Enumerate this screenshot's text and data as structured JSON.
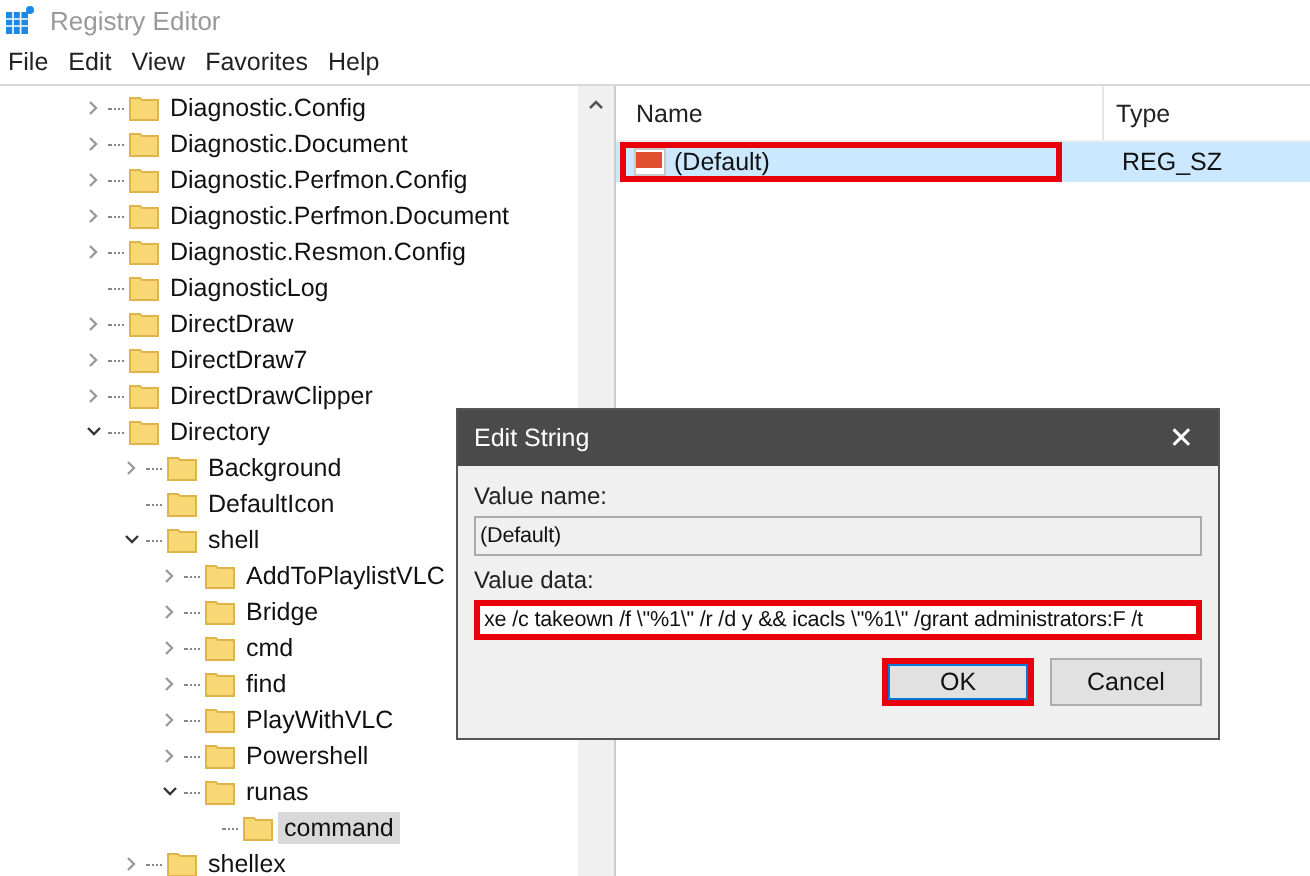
{
  "window": {
    "title": "Registry Editor"
  },
  "menu": [
    "File",
    "Edit",
    "View",
    "Favorites",
    "Help"
  ],
  "tree": [
    {
      "label": "Diagnostic.Config",
      "expandable": true,
      "expanded": false,
      "selected": false
    },
    {
      "label": "Diagnostic.Document",
      "expandable": true,
      "expanded": false,
      "selected": false
    },
    {
      "label": "Diagnostic.Perfmon.Config",
      "expandable": true,
      "expanded": false,
      "selected": false
    },
    {
      "label": "Diagnostic.Perfmon.Document",
      "expandable": true,
      "expanded": false,
      "selected": false
    },
    {
      "label": "Diagnostic.Resmon.Config",
      "expandable": true,
      "expanded": false,
      "selected": false
    },
    {
      "label": "DiagnosticLog",
      "expandable": false,
      "selected": false
    },
    {
      "label": "DirectDraw",
      "expandable": true,
      "expanded": false,
      "selected": false
    },
    {
      "label": "DirectDraw7",
      "expandable": true,
      "expanded": false,
      "selected": false
    },
    {
      "label": "DirectDrawClipper",
      "expandable": true,
      "expanded": false,
      "selected": false
    },
    {
      "label": "Directory",
      "expandable": true,
      "expanded": true,
      "selected": false,
      "children": [
        {
          "label": "Background",
          "expandable": true,
          "expanded": false,
          "selected": false
        },
        {
          "label": "DefaultIcon",
          "expandable": false,
          "selected": false
        },
        {
          "label": "shell",
          "expandable": true,
          "expanded": true,
          "selected": false,
          "children": [
            {
              "label": "AddToPlaylistVLC",
              "expandable": true,
              "expanded": false,
              "selected": false
            },
            {
              "label": "Bridge",
              "expandable": true,
              "expanded": false,
              "selected": false
            },
            {
              "label": "cmd",
              "expandable": true,
              "expanded": false,
              "selected": false
            },
            {
              "label": "find",
              "expandable": true,
              "expanded": false,
              "selected": false
            },
            {
              "label": "PlayWithVLC",
              "expandable": true,
              "expanded": false,
              "selected": false
            },
            {
              "label": "Powershell",
              "expandable": true,
              "expanded": false,
              "selected": false
            },
            {
              "label": "runas",
              "expandable": true,
              "expanded": true,
              "selected": false,
              "children": [
                {
                  "label": "command",
                  "expandable": false,
                  "selected": true
                }
              ]
            }
          ]
        },
        {
          "label": "shellex",
          "expandable": true,
          "expanded": false,
          "selected": false
        }
      ]
    }
  ],
  "values": {
    "columns": [
      "Name",
      "Type"
    ],
    "rows": [
      {
        "name": "(Default)",
        "type": "REG_SZ",
        "selected": true,
        "highlighted": true
      }
    ]
  },
  "dialog": {
    "title": "Edit String",
    "close": "✕",
    "name_label": "Value name:",
    "name_value": "(Default)",
    "data_label": "Value data:",
    "data_value": "xe /c takeown /f \\\"%1\\\" /r /d y && icacls \\\"%1\\\" /grant administrators:F /t",
    "data_highlighted": true,
    "buttons": [
      {
        "label": "OK",
        "default": true,
        "highlighted": true
      },
      {
        "label": "Cancel",
        "default": false,
        "highlighted": false
      }
    ]
  }
}
